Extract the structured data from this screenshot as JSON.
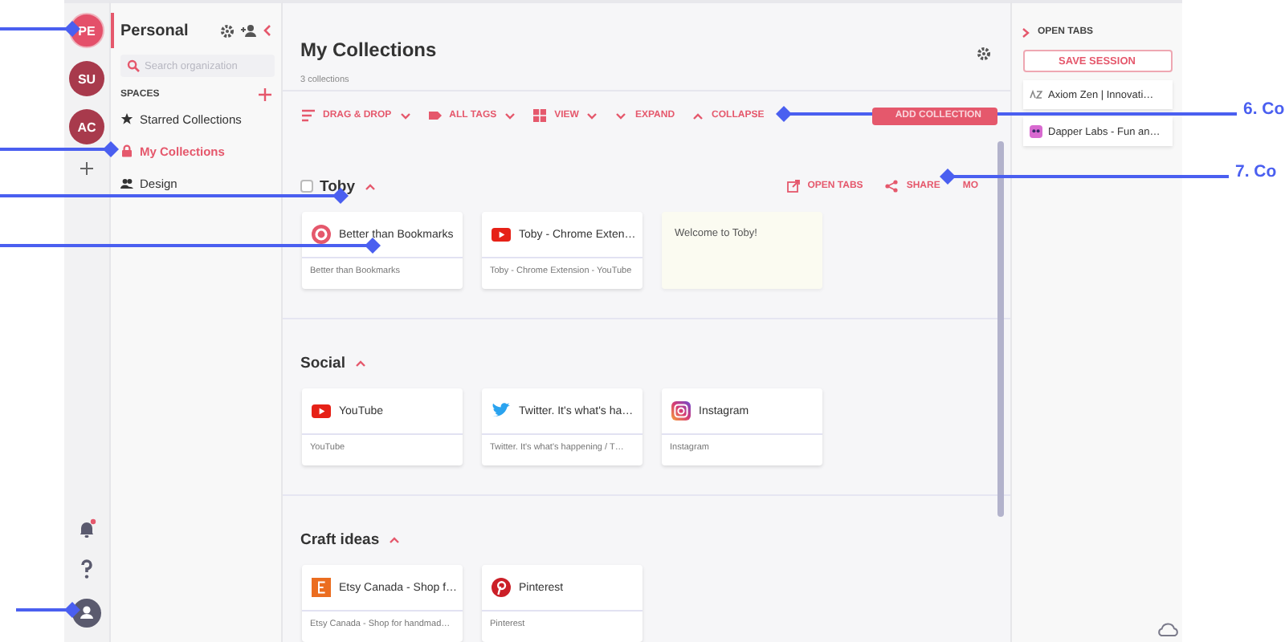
{
  "organizations": [
    {
      "initials": "PE",
      "color": "#e4506a",
      "selected": true
    },
    {
      "initials": "SU",
      "color": "#a83a4c",
      "selected": false
    },
    {
      "initials": "AC",
      "color": "#a83a4c",
      "selected": false
    }
  ],
  "sidebar": {
    "title": "Personal",
    "search": {
      "placeholder": "Search organization"
    },
    "spaces_heading": "SPACES",
    "spaces": [
      {
        "kind": "starred",
        "label": "Starred Collections",
        "selected": false
      },
      {
        "kind": "private",
        "label": "My Collections",
        "selected": true
      },
      {
        "kind": "team",
        "label": "Design",
        "selected": false
      }
    ]
  },
  "main": {
    "title": "My Collections",
    "subtitle": "3 collections",
    "toolbar": [
      {
        "kind": "drag",
        "label": "DRAG & DROP"
      },
      {
        "kind": "tags",
        "label": "ALL TAGS"
      },
      {
        "kind": "view",
        "label": "VIEW"
      },
      {
        "kind": "expand",
        "label": "EXPAND"
      },
      {
        "kind": "collapse",
        "label": "COLLAPSE"
      }
    ],
    "add_button": "ADD COLLECTION",
    "collections": [
      {
        "name": "Toby",
        "expanded": true,
        "checked": false,
        "actions": [
          {
            "kind": "open",
            "label": "OPEN TABS"
          },
          {
            "kind": "share",
            "label": "SHARE"
          },
          {
            "kind": "more",
            "label": "MO"
          }
        ],
        "cards": [
          {
            "kind": "toby",
            "title": "Better than Bookmarks",
            "description": "Better than Bookmarks"
          },
          {
            "kind": "youtube",
            "title": "Toby - Chrome Exten…",
            "description": "Toby - Chrome Extension - YouTube"
          },
          {
            "kind": "note",
            "text": "Welcome to Toby!"
          }
        ]
      },
      {
        "name": "Social",
        "expanded": true,
        "cards": [
          {
            "kind": "youtube",
            "title": "YouTube",
            "description": "YouTube"
          },
          {
            "kind": "twitter",
            "title": "Twitter. It's what's ha…",
            "description": "Twitter. It's what's happening / T…"
          },
          {
            "kind": "instagram",
            "title": "Instagram",
            "description": "Instagram"
          }
        ]
      },
      {
        "name": "Craft ideas",
        "expanded": true,
        "cards": [
          {
            "kind": "etsy",
            "title": "Etsy Canada - Shop f…",
            "description": "Etsy Canada - Shop for handmad…"
          },
          {
            "kind": "pinterest",
            "title": "Pinterest",
            "description": "Pinterest"
          }
        ]
      }
    ]
  },
  "open_tabs": {
    "title": "OPEN TABS",
    "save_button": "SAVE SESSION",
    "tabs": [
      {
        "kind": "axiom",
        "title": "Axiom Zen | Innovati…"
      },
      {
        "kind": "dapper",
        "title": "Dapper Labs - Fun an…"
      }
    ]
  },
  "annotations": [
    {
      "kind": "marker"
    },
    {
      "kind": "marker"
    },
    {
      "kind": "marker"
    },
    {
      "kind": "marker"
    },
    {
      "kind": "callout",
      "label": "6. Co"
    },
    {
      "kind": "callout",
      "label": "7. Co"
    },
    {
      "kind": "marker"
    }
  ]
}
